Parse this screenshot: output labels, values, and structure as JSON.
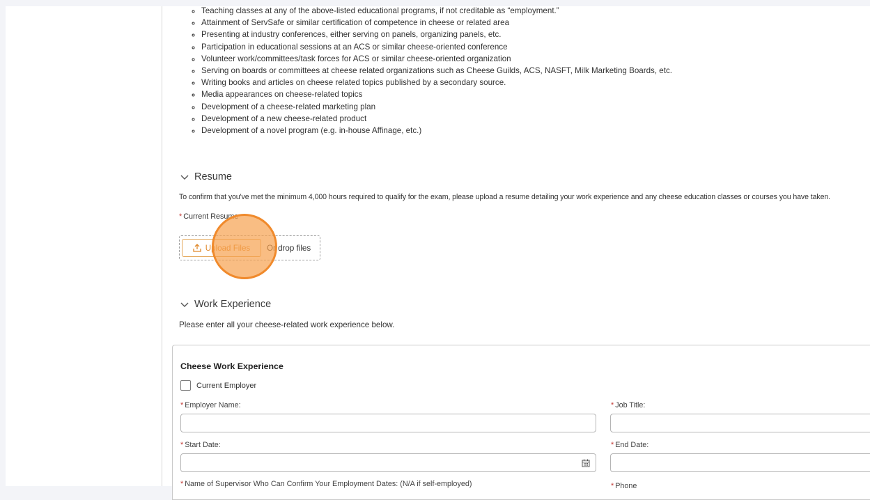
{
  "activities": {
    "items": [
      "Teaching classes at any of the above-listed educational programs, if not creditable as “employment.”",
      "Attainment of ServSafe or similar certification of competence in cheese or related area",
      "Presenting at industry conferences, either serving on panels, organizing panels, etc.",
      "Participation in educational sessions at an ACS or similar cheese-oriented conference",
      "Volunteer work/committees/task forces for ACS or similar cheese-oriented organization",
      "Serving on boards or committees at cheese related organizations such as Cheese Guilds, ACS, NASFT, Milk Marketing Boards, etc.",
      "Writing books and articles on cheese related topics published by a secondary source.",
      "Media appearances on cheese-related topics",
      "Development of a cheese-related marketing plan",
      "Development of a new cheese-related product",
      "Development of a novel program (e.g. in-house Affinage, etc.)"
    ]
  },
  "resume": {
    "title": "Resume",
    "description": "To confirm that you've met the minimum 4,000 hours required to qualify for the exam, please upload a resume detailing your work experience and any cheese education classes or courses you have taken.",
    "required_marker": "*",
    "field_label": "Current Resume",
    "upload_button": "Upload Files",
    "drop_label": "Or drop files"
  },
  "work_experience": {
    "title": "Work Experience",
    "description": "Please enter all your cheese-related work experience below.",
    "card_title": "Cheese Work Experience",
    "current_employer_label": "Current Employer",
    "employer_name_label": "Employer Name:",
    "job_title_label": "Job Title:",
    "start_date_label": "Start Date:",
    "end_date_label": "End Date:",
    "supervisor_label": "Name of Supervisor Who Can Confirm Your Employment Dates: (N/A if self-employed)",
    "phone_label": "Phone"
  },
  "colors": {
    "accent": "#e0892b",
    "required": "#c23934",
    "click_highlight": "#f08a2c"
  }
}
